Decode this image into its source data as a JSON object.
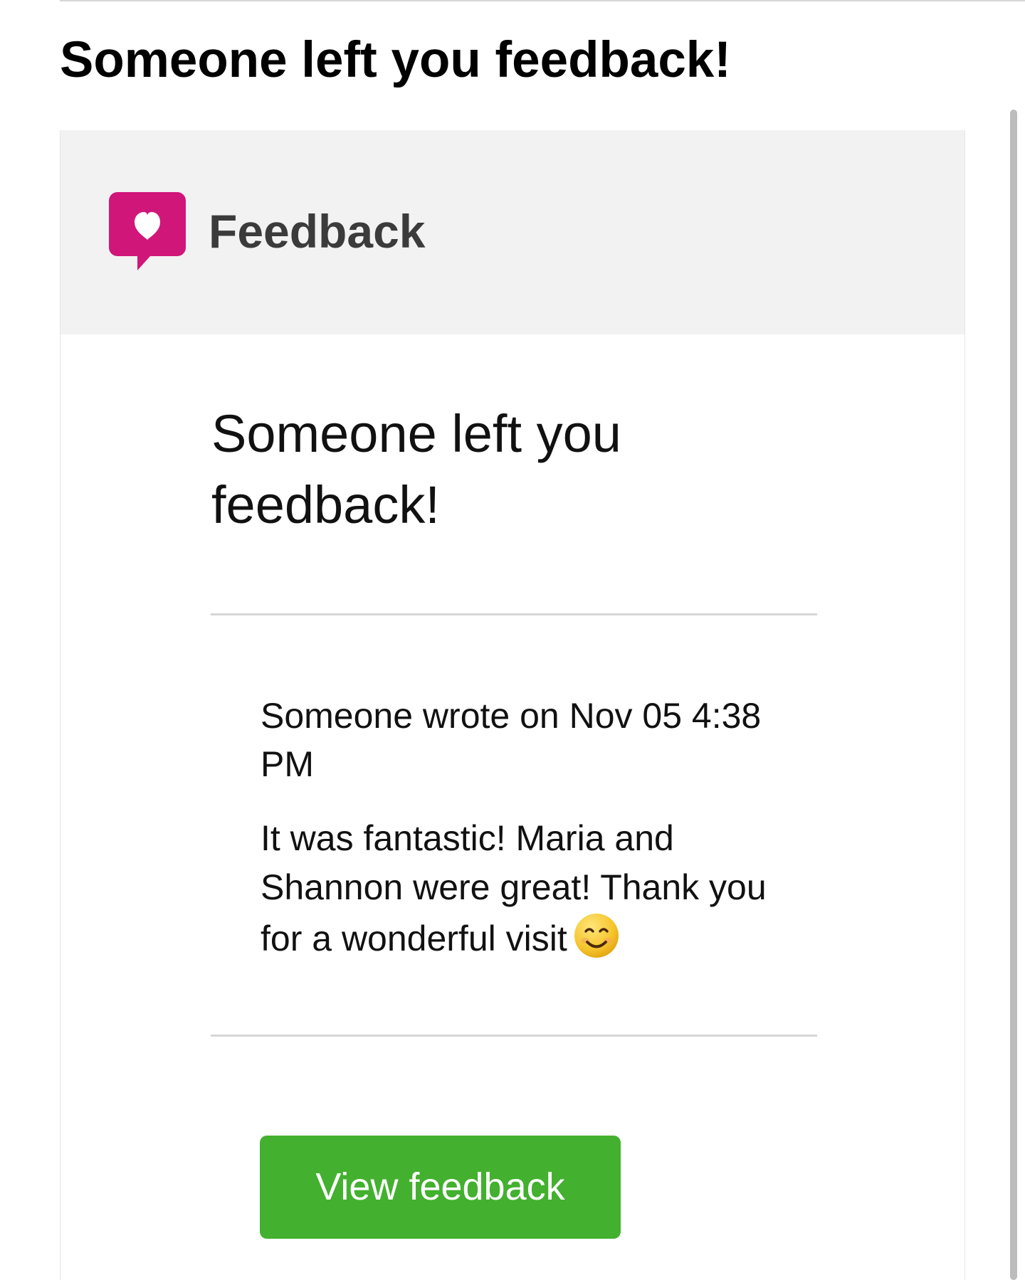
{
  "email": {
    "subject": "Someone left you feedback!"
  },
  "brand": {
    "name": "Feedback",
    "logo_icon": "heart-speech-bubble-icon",
    "logo_color": "#d1167a"
  },
  "content": {
    "heading": "Someone left you feedback!",
    "meta": "Someone wrote on Nov 05 4:38 PM",
    "comment": "It was fantastic! Maria and Shannon were great! Thank you for a wonderful visit",
    "emoji_icon": "smiling-face-icon"
  },
  "actions": {
    "view_feedback_label": "View feedback",
    "button_color": "#43b02f"
  },
  "colors": {
    "header_background": "#f2f2f2",
    "text": "#111111",
    "scrollbar": "#bcbcbc"
  }
}
